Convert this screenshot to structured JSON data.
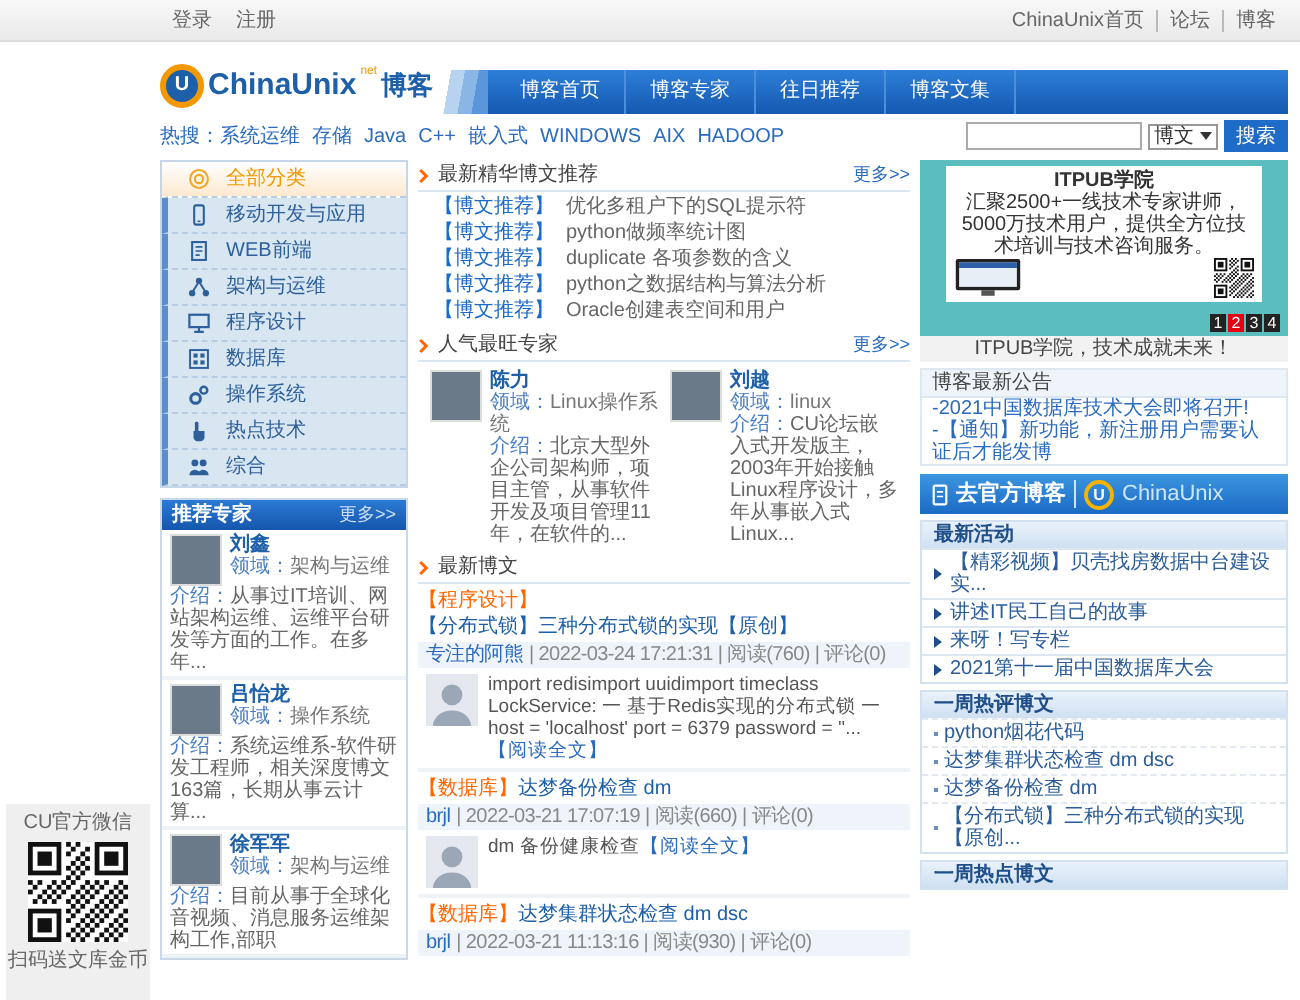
{
  "top_bar": {
    "left_links": [
      "登录",
      "注册"
    ],
    "right_links": [
      "ChinaUnix首页",
      "论坛",
      "博客"
    ]
  },
  "header": {
    "logo_letter": "U",
    "logo_text": "ChinaUnix",
    "logo_net": "net",
    "logo_suffix": "博客",
    "nav": [
      "博客首页",
      "博客专家",
      "往日推荐",
      "博客文集"
    ]
  },
  "hot_search": {
    "label": "热搜：",
    "terms": [
      "系统运维",
      "存储",
      "Java",
      "C++",
      "嵌入式",
      "WINDOWS",
      "AIX",
      "HADOOP"
    ]
  },
  "search": {
    "type_value": "博文",
    "button": "搜索"
  },
  "categories": [
    {
      "label": "全部分类",
      "selected": true
    },
    {
      "label": "移动开发与应用",
      "selected": false
    },
    {
      "label": "WEB前端",
      "selected": false
    },
    {
      "label": "架构与运维",
      "selected": false
    },
    {
      "label": "程序设计",
      "selected": false
    },
    {
      "label": "数据库",
      "selected": false
    },
    {
      "label": "操作系统",
      "selected": false
    },
    {
      "label": "热点技术",
      "selected": false
    },
    {
      "label": "综合",
      "selected": false
    }
  ],
  "sidebar_experts": {
    "title": "推荐专家",
    "more": "更多>>",
    "items": [
      {
        "name": "刘鑫",
        "field_label": "领域：",
        "field": "架构与运维",
        "intro_label": "介绍：",
        "intro": "从事过IT培训、网站架构运维、运维平台研发等方面的工作。在多年..."
      },
      {
        "name": "吕怡龙",
        "field_label": "领域：",
        "field": "操作系统",
        "intro_label": "介绍：",
        "intro": "系统运维系-软件研发工程师，相关深度博文163篇，长期从事云计算..."
      },
      {
        "name": "徐军军",
        "field_label": "领域：",
        "field": "架构与运维",
        "intro_label": "介绍：",
        "intro": "目前从事于全球化音视频、消息服务运维架构工作,部职"
      }
    ]
  },
  "featured": {
    "title": "最新精华博文推荐",
    "more": "更多>>",
    "items": [
      {
        "tag": "【博文推荐】",
        "title": "优化多租户下的SQL提示符"
      },
      {
        "tag": "【博文推荐】",
        "title": "python做频率统计图"
      },
      {
        "tag": "【博文推荐】",
        "title": "duplicate 各项参数的含义"
      },
      {
        "tag": "【博文推荐】",
        "title": "python之数据结构与算法分析"
      },
      {
        "tag": "【博文推荐】",
        "title": "Oracle创建表空间和用户"
      }
    ]
  },
  "popular_experts": {
    "title": "人气最旺专家",
    "more": "更多>>",
    "items": [
      {
        "name": "陈力",
        "field_label": "领域：",
        "field": "Linux操作系统",
        "intro_label": "介绍：",
        "intro": "北京大型外企公司架构师，项目主管，从事软件开发及项目管理11年，在软件的..."
      },
      {
        "name": "刘越",
        "field_label": "领域：",
        "field": "linux",
        "intro_label": "介绍：",
        "intro": "CU论坛嵌入式开发版主，2003年开始接触Linux程序设计，多年从事嵌入式Linux..."
      }
    ]
  },
  "latest": {
    "title": "最新博文",
    "posts": [
      {
        "category": "【程序设计】",
        "title": "【分布式锁】三种分布式锁的实现【原创】",
        "author": "专注的阿熊",
        "meta": "| 2022-03-24 17:21:31 | 阅读(760) | 评论(0)",
        "excerpt": "import redisimport uuidimport timeclass LockService: 一 基于Redis实现的分布式锁 一 host = 'localhost' port = 6379 password = ''...",
        "read_more": "【阅读全文】"
      },
      {
        "category": "【数据库】",
        "title": "达梦备份检查 dm",
        "author": "brjl",
        "meta": "| 2022-03-21 17:07:19 | 阅读(660) | 评论(0)",
        "excerpt": "dm 备份健康检查",
        "read_more": "【阅读全文】"
      },
      {
        "category": "【数据库】",
        "title": "达梦集群状态检查 dm dsc",
        "author": "brjl",
        "meta": "| 2022-03-21 11:13:16 | 阅读(930) | 评论(0)"
      }
    ]
  },
  "ad": {
    "brand": "ITPUB学院",
    "text": "汇聚2500+一线技术专家讲师，5000万技术用户，提供全方位技术培训与技术咨询服务。",
    "slides": [
      {
        "label": "1",
        "selected": false
      },
      {
        "label": "2",
        "selected": true
      },
      {
        "label": "3",
        "selected": false
      },
      {
        "label": "4",
        "selected": false
      }
    ],
    "caption": "ITPUB学院，技术成就未来！"
  },
  "notices": {
    "title": "博客最新公告",
    "items": [
      "-2021中国数据库技术大会即将召开!",
      "-【通知】新功能，新注册用户需要认证后才能发博"
    ]
  },
  "official_banner": {
    "label": "去官方博客",
    "logo_letter": "U",
    "brand": "ChinaUnix"
  },
  "activities": {
    "title": "最新活动",
    "items": [
      "【精彩视频】贝壳找房数据中台建设实...",
      "讲述IT民工自己的故事",
      "来呀！写专栏",
      "2021第十一届中国数据库大会"
    ]
  },
  "weekly_reviewed": {
    "title": "一周热评博文",
    "items": [
      "python烟花代码",
      "达梦集群状态检查 dm dsc",
      "达梦备份检查 dm",
      "【分布式锁】三种分布式锁的实现【原创..."
    ]
  },
  "weekly_hot": {
    "title": "一周热点博文"
  },
  "wechat": {
    "title": "CU官方微信",
    "caption": "扫码送文库金币"
  }
}
